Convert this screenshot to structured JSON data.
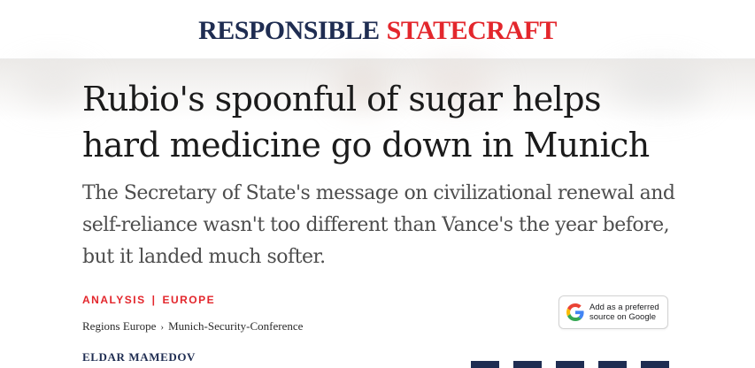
{
  "masthead": {
    "logo_part1": "RESPONSIBLE",
    "logo_part2": "STATECRAFT"
  },
  "article": {
    "headline_line1": "Rubio's spoonful of sugar helps",
    "headline_line2": "hard medicine go down in Munich",
    "dek_line1": "The Secretary of State's message on civilizational renewal and",
    "dek_line2": "self-reliance wasn't too different than Vance's the year before,",
    "dek_line3": "but it landed much softer.",
    "tags": [
      "ANALYSIS",
      "EUROPE"
    ],
    "tag_separator": "|",
    "breadcrumbs": [
      "Regions Europe",
      "Munich-Security-Conference"
    ],
    "breadcrumb_separator": "›",
    "author": "ELDAR MAMEDOV"
  },
  "google_button": {
    "line1": "Add as a preferred",
    "line2": "source on Google",
    "icon": "google-g-icon"
  },
  "share_buttons": [
    "share-button",
    "share-button",
    "share-button",
    "share-button",
    "share-button"
  ],
  "colors": {
    "brand_navy": "#1f2d52",
    "brand_red": "#e3262c",
    "headline_text": "#1b1b1b",
    "dek_text": "#4d4d4d"
  }
}
